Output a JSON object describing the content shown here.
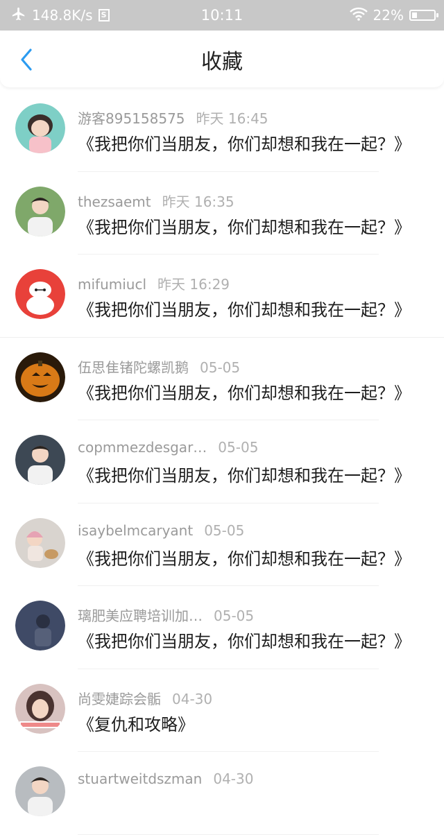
{
  "status_bar": {
    "speed": "148.8K/s",
    "s_badge": "S",
    "time": "10:11",
    "battery": "22%",
    "battery_level": 0.22
  },
  "nav": {
    "title": "收藏"
  },
  "items": [
    {
      "name": "游客895158575",
      "date": "昨天 16:45",
      "title": "《我把你们当朋友，你们却想和我在一起？》",
      "avatar_icon": "cartoon-girl-avatar",
      "avatar_color": "#7ecfc6"
    },
    {
      "name": "thezsaemt",
      "date": "昨天 16:35",
      "title": "《我把你们当朋友，你们却想和我在一起？》",
      "avatar_icon": "young-man-avatar",
      "avatar_color": "#7fa86a"
    },
    {
      "name": "mifumiucl",
      "date": "昨天 16:29",
      "title": "《我把你们当朋友，你们却想和我在一起？》",
      "avatar_icon": "white-robot-avatar",
      "avatar_color": "#e8413a"
    },
    {
      "name": "伍思隹锗陀螺凯鹅",
      "date": "05-05",
      "title": "《我把你们当朋友，你们却想和我在一起？》",
      "avatar_icon": "pumpkin-avatar",
      "avatar_color": "#d97a17"
    },
    {
      "name": "copmmezdesgar…",
      "date": "05-05",
      "title": "《我把你们当朋友，你们却想和我在一起？》",
      "avatar_icon": "man-portrait-avatar",
      "avatar_color": "#3d4854"
    },
    {
      "name": "isaybelmcaryant",
      "date": "05-05",
      "title": "《我把你们当朋友，你们却想和我在一起？》",
      "avatar_icon": "girl-with-dog-avatar",
      "avatar_color": "#d9d4cf"
    },
    {
      "name": "璃肥美应聘培训加…",
      "date": "05-05",
      "title": "《我把你们当朋友，你们却想和我在一起？》",
      "avatar_icon": "night-figure-avatar",
      "avatar_color": "#3f4a66"
    },
    {
      "name": "尚雯婕踪会骺",
      "date": "04-30",
      "title": "《复仇和攻略》",
      "avatar_icon": "girl-portrait-avatar",
      "avatar_color": "#d8c2c0"
    },
    {
      "name": "stuartweitdszman",
      "date": "04-30",
      "title": "",
      "avatar_icon": "person-avatar",
      "avatar_color": "#b8bcc0"
    }
  ]
}
